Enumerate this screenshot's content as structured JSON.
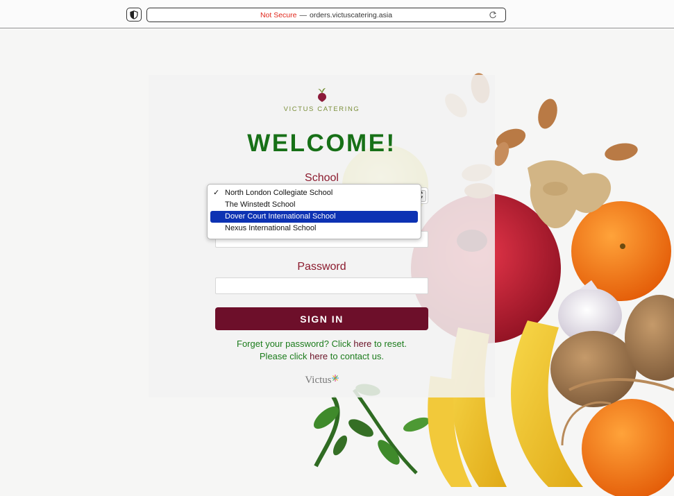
{
  "browser": {
    "security_label": "Not Secure",
    "separator": "—",
    "url": "orders.victuscatering.asia"
  },
  "logo": {
    "text": "VICTUS CATERING"
  },
  "login": {
    "heading": "WELCOME!",
    "school_label": "School",
    "password_label": "Password",
    "signin_label": "SIGN IN",
    "help_line1_prefix": "Forget your password? Click ",
    "help_line1_link": "here",
    "help_line1_suffix": " to reset.",
    "help_line2_prefix": "Please click ",
    "help_line2_link": "here",
    "help_line2_suffix": " to contact us.",
    "footer_logo": "Victus"
  },
  "school_dropdown": {
    "options": [
      {
        "label": "North London Collegiate School",
        "checked": true,
        "highlighted": false
      },
      {
        "label": "The Winstedt School",
        "checked": false,
        "highlighted": false
      },
      {
        "label": "Dover Court International School",
        "checked": false,
        "highlighted": true
      },
      {
        "label": "Nexus International School",
        "checked": false,
        "highlighted": false
      }
    ]
  },
  "colors": {
    "brand_green": "#177017",
    "brand_maroon": "#6d0f2a",
    "highlight_blue": "#0d32b3",
    "not_secure_red": "#e0261b"
  }
}
